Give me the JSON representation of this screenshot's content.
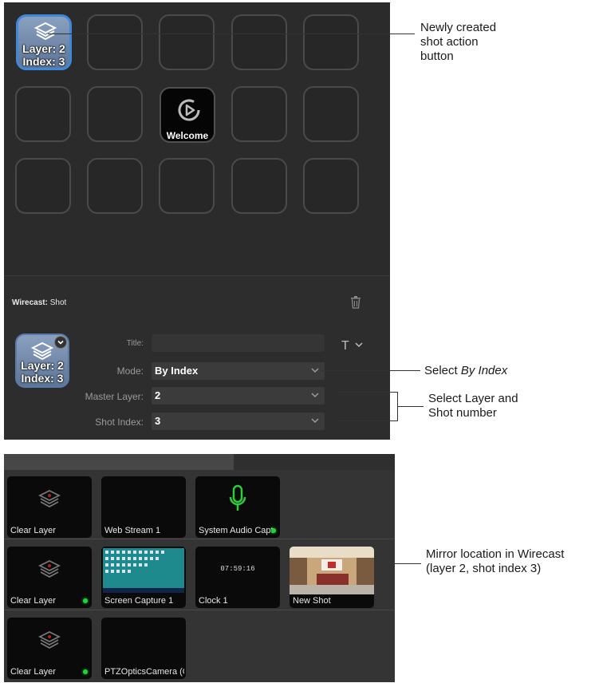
{
  "deck": {
    "selected_key": {
      "line1": "Layer: 2",
      "line2": "Index: 3"
    },
    "welcome_key": {
      "label": "Welcome"
    },
    "properties": {
      "header_app": "Wirecast:",
      "header_action": "Shot",
      "preview": {
        "line1": "Layer: 2",
        "line2": "Index: 3"
      },
      "title_label": "Title:",
      "title_value": "",
      "title_tool": "T",
      "mode_label": "Mode:",
      "mode_value": "By Index",
      "master_layer_label": "Master Layer:",
      "master_layer_value": "2",
      "shot_index_label": "Shot Index:",
      "shot_index_value": "3"
    }
  },
  "wirecast": {
    "rows": [
      [
        {
          "label": "Clear Layer",
          "icon": "layers-icon",
          "live": false
        },
        {
          "label": "Web Stream 1",
          "icon": "",
          "live": false
        },
        {
          "label": "System Audio Capt",
          "icon": "microphone-icon",
          "live": true
        }
      ],
      [
        {
          "label": "Clear Layer",
          "icon": "layers-icon",
          "live": true
        },
        {
          "label": "Screen Capture 1",
          "icon": "desktop-thumbnail",
          "live": false
        },
        {
          "label": "Clock 1",
          "icon": "",
          "clock": "07:59:16",
          "live": false
        },
        {
          "label": "New Shot",
          "icon": "studio-thumbnail",
          "live": false
        }
      ],
      [
        {
          "label": "Clear Layer",
          "icon": "layers-icon",
          "live": true
        },
        {
          "label": "PTZOpticsCamera (Cl",
          "icon": "",
          "live": false
        }
      ]
    ]
  },
  "annotations": {
    "newly_created": [
      "Newly created",
      "shot action",
      "button"
    ],
    "select_by_index_prefix": "Select ",
    "select_by_index_em": "By Index",
    "select_layer": [
      "Select Layer and",
      "Shot number"
    ],
    "mirror": [
      "Mirror location in Wirecast",
      "(layer 2, shot index 3)"
    ]
  },
  "colors": {
    "accent": "#3f88d8",
    "live": "#21d33a"
  }
}
